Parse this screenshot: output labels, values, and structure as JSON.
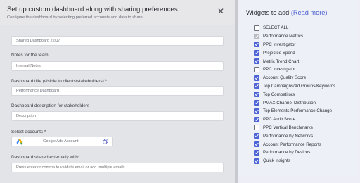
{
  "dialog": {
    "title": "Set up custom dashboard along with sharing preferences",
    "subtitle": "Configure the dashboard by selecting preferred accounts and data to share",
    "close_glyph": "✕"
  },
  "fields": {
    "dashboard_name": {
      "value": "Shared Dashboard 22/07"
    },
    "notes": {
      "label": "Notes for the team",
      "placeholder": "Internal Notes"
    },
    "title": {
      "label": "Dashboard title (visible to clients/stakeholders) *",
      "value": "Performance Dashboard"
    },
    "description": {
      "label": "Dashboard description for stakeholders",
      "placeholder": "Description"
    },
    "accounts": {
      "label": "Select accounts *",
      "chip_label": "Google Ads Account"
    },
    "shared_with": {
      "label": "Dashboard shared externally with*",
      "placeholder": "Press enter or comma to validate email or add  multiple emails"
    }
  },
  "widgets": {
    "heading": "Widgets to add",
    "read_more": "(Read more)",
    "items": [
      {
        "label": "SELECT ALL",
        "state": "unchecked"
      },
      {
        "label": "Performance Metrics",
        "state": "disabled"
      },
      {
        "label": "PPC Investigator",
        "state": "checked"
      },
      {
        "label": "Projected Spend",
        "state": "checked"
      },
      {
        "label": "Metric Trend Chart",
        "state": "checked"
      },
      {
        "label": "PPC Investigator",
        "state": "unchecked"
      },
      {
        "label": "Account Quality Score",
        "state": "checked"
      },
      {
        "label": "Top Campaigns/Ad Groups/Keywords",
        "state": "checked"
      },
      {
        "label": "Top Competitors",
        "state": "checked"
      },
      {
        "label": "PMAX Channel Distribution",
        "state": "checked"
      },
      {
        "label": "Top Elements Performance Change",
        "state": "checked"
      },
      {
        "label": "PPC Audit Score",
        "state": "checked"
      },
      {
        "label": "PPC Vertical Benchmarks",
        "state": "unchecked"
      },
      {
        "label": "Performance by Networks",
        "state": "checked"
      },
      {
        "label": "Account Performance Reports",
        "state": "checked"
      },
      {
        "label": "Performance by Devices",
        "state": "checked"
      },
      {
        "label": "Quick Insights",
        "state": "checked"
      }
    ]
  },
  "colors": {
    "accent": "#4d64d6",
    "link": "#4a5fd0",
    "disabled_check": "#b9bac0"
  }
}
